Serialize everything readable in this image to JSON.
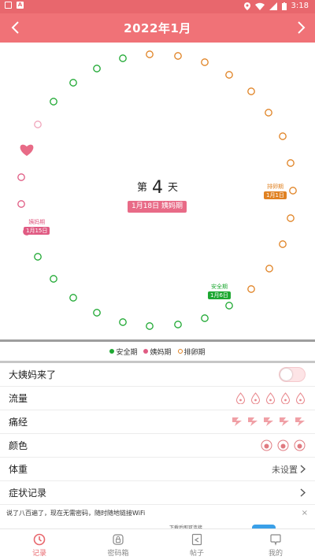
{
  "status_bar": {
    "time": "3:18",
    "left_icons": [
      "app-icon-square",
      "app-icon-a"
    ],
    "right_icons": [
      "location-icon",
      "wifi-icon",
      "signal-icon",
      "battery-icon"
    ]
  },
  "header": {
    "title": "2022年1月",
    "prev_icon": "chevron-left-icon",
    "next_icon": "chevron-right-icon",
    "color": "#f07277"
  },
  "cycle": {
    "day_prefix": "第",
    "day_number": "4",
    "day_suffix": "天",
    "current_badge": "1月18日 姨妈期",
    "period_mark": {
      "label": "姨妈期",
      "date": "1月15日"
    },
    "ovulation_mark": {
      "label": "排卵期",
      "date": "1月1日"
    },
    "safe_mark": {
      "label": "安全期",
      "date": "1月6日"
    },
    "colors": {
      "safe": "#1ea832",
      "period": "#e05b83",
      "ovulation": "#e08223"
    }
  },
  "legend": {
    "safe": "安全期",
    "period": "姨妈期",
    "ovulation": "排卵期"
  },
  "rows": {
    "period_came": {
      "label": "大姨妈来了",
      "toggle_on": false
    },
    "flow": {
      "label": "流量",
      "icon": "droplet-icon"
    },
    "pain": {
      "label": "痛经",
      "icon": "lightning-icon"
    },
    "color": {
      "label": "颜色",
      "icon": "color-swatch-icon"
    },
    "weight": {
      "label": "体重",
      "value": "未设置"
    },
    "symptoms": {
      "label": "症状记录"
    }
  },
  "ad": {
    "text": "说了八百遍了，现在无需密码，随时随地链接WiFi",
    "sub": "下载后即可连接",
    "close": "×"
  },
  "tabs": [
    {
      "label": "记录",
      "icon": "clock-icon",
      "active": true
    },
    {
      "label": "密码箱",
      "icon": "lock-icon",
      "active": false
    },
    {
      "label": "帖子",
      "icon": "post-icon",
      "active": false
    },
    {
      "label": "我的",
      "icon": "profile-icon",
      "active": false
    }
  ]
}
